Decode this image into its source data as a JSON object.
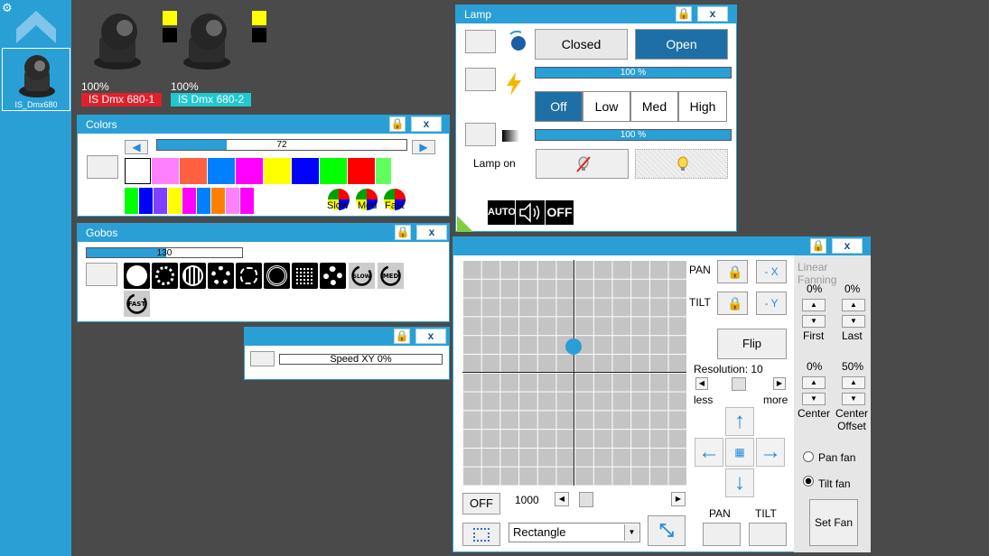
{
  "sidebar": {
    "fixture_label": "IS_Dmx680"
  },
  "fixtures": [
    {
      "intensity": "100%",
      "name": "IS Dmx 680-1",
      "name_color": "#e0202a"
    },
    {
      "intensity": "100%",
      "name": "IS Dmx 680-2",
      "name_color": "#20c8d0"
    }
  ],
  "colors_window": {
    "title": "Colors",
    "slider_value": "72",
    "slider_fraction": 0.28,
    "row1": [
      "#ffffff",
      "#ff80ff",
      "#ff6040",
      "#0080ff",
      "#ff00ff",
      "#ffff00",
      "#0000ff",
      "#00ff00",
      "#ff0000",
      "#60ff60"
    ],
    "row2": [
      "#00ff00",
      "#0000ff",
      "#8040ff",
      "#ffff00",
      "#ff00ff",
      "#0080ff",
      "#ff8000",
      "#ff80ff",
      "#ff00ff",
      "#ffffff"
    ],
    "speed_labels": [
      "Slow",
      "Med",
      "Fast"
    ]
  },
  "gobos_window": {
    "title": "Gobos",
    "slider_value": "130",
    "slider_fraction": 0.51
  },
  "speed_window": {
    "label": "Speed XY    0%"
  },
  "lamp_window": {
    "title": "Lamp",
    "shutter": {
      "closed": "Closed",
      "open": "Open"
    },
    "dimmer_value": "100 %",
    "strobe": {
      "off": "Off",
      "low": "Low",
      "med": "Med",
      "high": "High"
    },
    "focus_value": "100 %",
    "lamp_on_label": "Lamp on",
    "auto_label": "AUTO",
    "off_label": "OFF"
  },
  "pantilt_window": {
    "pan_label": "PAN",
    "tilt_label": "TILT",
    "minus_x": "- X",
    "minus_y": "- Y",
    "flip": "Flip",
    "resolution": "Resolution: 10",
    "less": "less",
    "more": "more",
    "fanning_title": "Linear Fanning",
    "first_pct": "0%",
    "last_pct": "0%",
    "first": "First",
    "last": "Last",
    "center_pct": "0%",
    "offset_pct": "50%",
    "center": "Center",
    "center_offset": "Center\nOffset",
    "pan_fan": "Pan fan",
    "tilt_fan": "Tilt fan",
    "set_fan": "Set Fan",
    "off_btn": "OFF",
    "speed_value": "1000",
    "shape": "Rectangle",
    "pan_bottom": "PAN",
    "tilt_bottom": "TILT",
    "accent": "#2a9fd6"
  }
}
